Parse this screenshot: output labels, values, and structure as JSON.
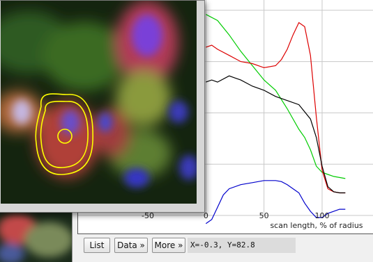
{
  "image_window": {
    "roi_shape": "oval",
    "roi_color": "#ffff00",
    "colors": {
      "red_channel": "#d23a3a",
      "green_channel": "#5fa33a",
      "blue_channel": "#3b3bd8"
    }
  },
  "plot_window": {
    "buttons": {
      "list": "List",
      "data": "Data »",
      "more": "More »"
    },
    "coordinates": "X=-0.3, Y=82.8"
  },
  "chart_data": {
    "type": "line",
    "xlabel": "scan length, % of radius",
    "ylabel": "",
    "xlim": [
      -110,
      145
    ],
    "ylim": [
      0,
      105
    ],
    "x_ticks": [
      -50,
      0,
      50,
      100
    ],
    "grid": true,
    "series": [
      {
        "color": "#00cc00",
        "x": [
          0,
          10,
          20,
          30,
          40,
          50,
          60,
          70,
          80,
          85,
          90,
          95,
          100,
          105,
          110,
          115,
          120
        ],
        "y": [
          98,
          95,
          88,
          80,
          73,
          66,
          61,
          52,
          42,
          38,
          32,
          24,
          21,
          20,
          19,
          18.5,
          18
        ]
      },
      {
        "color": "#dd0000",
        "x": [
          0,
          5,
          10,
          20,
          30,
          40,
          50,
          60,
          65,
          70,
          75,
          80,
          85,
          90,
          95,
          100,
          105,
          110,
          115,
          120
        ],
        "y": [
          82,
          83,
          81,
          78,
          75,
          74,
          72,
          73,
          76,
          81,
          88,
          94,
          92,
          78,
          48,
          22,
          13,
          11.5,
          11,
          11
        ]
      },
      {
        "color": "#000000",
        "x": [
          0,
          5,
          10,
          20,
          25,
          30,
          40,
          50,
          60,
          70,
          80,
          90,
          95,
          100,
          105,
          110,
          115,
          120
        ],
        "y": [
          65,
          66,
          65,
          68,
          67,
          66,
          63,
          61,
          58,
          56,
          54,
          47,
          38,
          24,
          14,
          11.5,
          11,
          11
        ]
      },
      {
        "color": "#0000cc",
        "x": [
          0,
          5,
          10,
          15,
          20,
          30,
          40,
          50,
          60,
          65,
          70,
          75,
          80,
          85,
          90,
          95,
          100,
          105,
          110,
          115,
          120
        ],
        "y": [
          -4,
          -2,
          4,
          10,
          13,
          15,
          16,
          17,
          17,
          16.5,
          15,
          13,
          11,
          6,
          2,
          -1,
          -1,
          1,
          2,
          3,
          3
        ]
      }
    ]
  }
}
